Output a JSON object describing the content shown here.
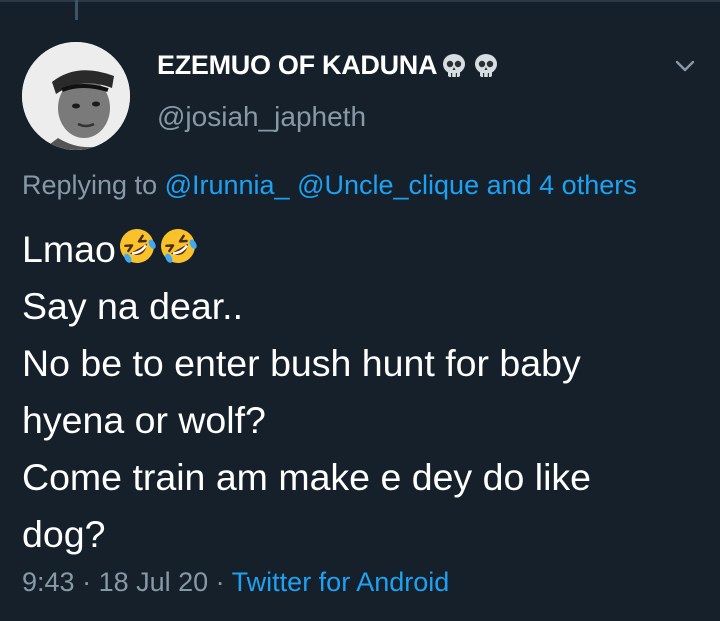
{
  "tweet": {
    "display_name": "EZEMUO OF KADUNA",
    "name_emojis": [
      "skull-icon",
      "skull-icon"
    ],
    "handle": "@josiah_japheth",
    "replying": {
      "prefix": "Replying to ",
      "mention_1": "@Irunnia_",
      "mention_2": "@Uncle_clique",
      "suffix": "and 4 others"
    },
    "text_lines": [
      "Lmao",
      "Say na dear..",
      "No be to enter bush hunt for baby",
      "hyena or wolf?",
      "Come train am make e dey do like",
      "dog?"
    ],
    "text_emojis": [
      "rolling-on-floor-laughing-icon",
      "rolling-on-floor-laughing-icon"
    ],
    "time": "9:43",
    "separator": " · ",
    "date": "18 Jul 20",
    "source": "Twitter for Android"
  },
  "colors": {
    "background": "#15202b",
    "text": "#ffffff",
    "muted": "#8899a6",
    "link": "#1da1f2"
  }
}
